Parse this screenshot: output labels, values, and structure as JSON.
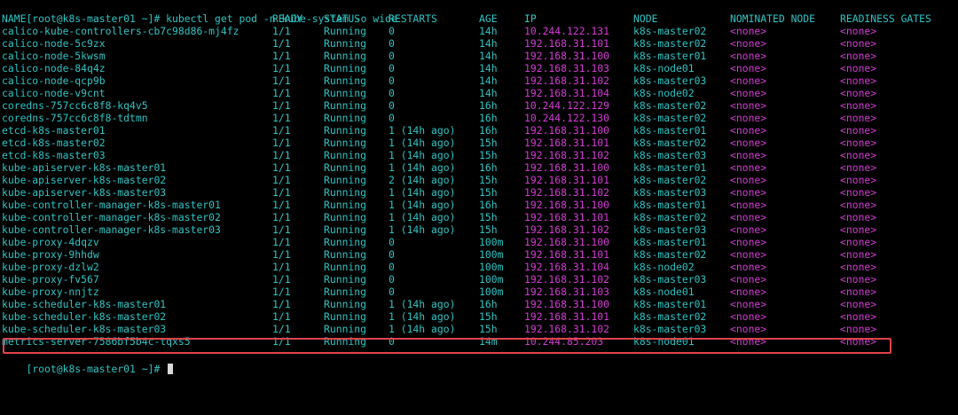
{
  "terminal": {
    "prompt": "[root@k8s-master01 ~]# ",
    "command": "kubectl get pod -n kube-system -o wide",
    "headers": {
      "name": "NAME",
      "ready": "READY",
      "status": "STATUS",
      "restarts": "RESTARTS",
      "age": "AGE",
      "ip": "IP",
      "node": "NODE",
      "nominated": "NOMINATED NODE",
      "readiness": "READINESS GATES"
    },
    "rows": [
      {
        "name": "calico-kube-controllers-cb7c98d86-mj4fz",
        "ready": "1/1",
        "status": "Running",
        "restarts": "0",
        "age": "14h",
        "ip": "10.244.122.131",
        "node": "k8s-master02",
        "nominated": "<none>",
        "readiness": "<none>"
      },
      {
        "name": "calico-node-5c9zx",
        "ready": "1/1",
        "status": "Running",
        "restarts": "0",
        "age": "14h",
        "ip": "192.168.31.101",
        "node": "k8s-master02",
        "nominated": "<none>",
        "readiness": "<none>"
      },
      {
        "name": "calico-node-5kwsm",
        "ready": "1/1",
        "status": "Running",
        "restarts": "0",
        "age": "14h",
        "ip": "192.168.31.100",
        "node": "k8s-master01",
        "nominated": "<none>",
        "readiness": "<none>"
      },
      {
        "name": "calico-node-84q4z",
        "ready": "1/1",
        "status": "Running",
        "restarts": "0",
        "age": "14h",
        "ip": "192.168.31.103",
        "node": "k8s-node01",
        "nominated": "<none>",
        "readiness": "<none>"
      },
      {
        "name": "calico-node-qcp9b",
        "ready": "1/1",
        "status": "Running",
        "restarts": "0",
        "age": "14h",
        "ip": "192.168.31.102",
        "node": "k8s-master03",
        "nominated": "<none>",
        "readiness": "<none>"
      },
      {
        "name": "calico-node-v9cnt",
        "ready": "1/1",
        "status": "Running",
        "restarts": "0",
        "age": "14h",
        "ip": "192.168.31.104",
        "node": "k8s-node02",
        "nominated": "<none>",
        "readiness": "<none>"
      },
      {
        "name": "coredns-757cc6c8f8-kq4v5",
        "ready": "1/1",
        "status": "Running",
        "restarts": "0",
        "age": "16h",
        "ip": "10.244.122.129",
        "node": "k8s-master02",
        "nominated": "<none>",
        "readiness": "<none>"
      },
      {
        "name": "coredns-757cc6c8f8-tdtmn",
        "ready": "1/1",
        "status": "Running",
        "restarts": "0",
        "age": "16h",
        "ip": "10.244.122.130",
        "node": "k8s-master02",
        "nominated": "<none>",
        "readiness": "<none>"
      },
      {
        "name": "etcd-k8s-master01",
        "ready": "1/1",
        "status": "Running",
        "restarts": "1 (14h ago)",
        "age": "16h",
        "ip": "192.168.31.100",
        "node": "k8s-master01",
        "nominated": "<none>",
        "readiness": "<none>"
      },
      {
        "name": "etcd-k8s-master02",
        "ready": "1/1",
        "status": "Running",
        "restarts": "1 (14h ago)",
        "age": "15h",
        "ip": "192.168.31.101",
        "node": "k8s-master02",
        "nominated": "<none>",
        "readiness": "<none>"
      },
      {
        "name": "etcd-k8s-master03",
        "ready": "1/1",
        "status": "Running",
        "restarts": "1 (14h ago)",
        "age": "15h",
        "ip": "192.168.31.102",
        "node": "k8s-master03",
        "nominated": "<none>",
        "readiness": "<none>"
      },
      {
        "name": "kube-apiserver-k8s-master01",
        "ready": "1/1",
        "status": "Running",
        "restarts": "1 (14h ago)",
        "age": "16h",
        "ip": "192.168.31.100",
        "node": "k8s-master01",
        "nominated": "<none>",
        "readiness": "<none>"
      },
      {
        "name": "kube-apiserver-k8s-master02",
        "ready": "1/1",
        "status": "Running",
        "restarts": "2 (14h ago)",
        "age": "15h",
        "ip": "192.168.31.101",
        "node": "k8s-master02",
        "nominated": "<none>",
        "readiness": "<none>"
      },
      {
        "name": "kube-apiserver-k8s-master03",
        "ready": "1/1",
        "status": "Running",
        "restarts": "1 (14h ago)",
        "age": "15h",
        "ip": "192.168.31.102",
        "node": "k8s-master03",
        "nominated": "<none>",
        "readiness": "<none>"
      },
      {
        "name": "kube-controller-manager-k8s-master01",
        "ready": "1/1",
        "status": "Running",
        "restarts": "1 (14h ago)",
        "age": "16h",
        "ip": "192.168.31.100",
        "node": "k8s-master01",
        "nominated": "<none>",
        "readiness": "<none>"
      },
      {
        "name": "kube-controller-manager-k8s-master02",
        "ready": "1/1",
        "status": "Running",
        "restarts": "1 (14h ago)",
        "age": "15h",
        "ip": "192.168.31.101",
        "node": "k8s-master02",
        "nominated": "<none>",
        "readiness": "<none>"
      },
      {
        "name": "kube-controller-manager-k8s-master03",
        "ready": "1/1",
        "status": "Running",
        "restarts": "1 (14h ago)",
        "age": "15h",
        "ip": "192.168.31.102",
        "node": "k8s-master03",
        "nominated": "<none>",
        "readiness": "<none>"
      },
      {
        "name": "kube-proxy-4dqzv",
        "ready": "1/1",
        "status": "Running",
        "restarts": "0",
        "age": "100m",
        "ip": "192.168.31.100",
        "node": "k8s-master01",
        "nominated": "<none>",
        "readiness": "<none>"
      },
      {
        "name": "kube-proxy-9hhdw",
        "ready": "1/1",
        "status": "Running",
        "restarts": "0",
        "age": "100m",
        "ip": "192.168.31.101",
        "node": "k8s-master02",
        "nominated": "<none>",
        "readiness": "<none>"
      },
      {
        "name": "kube-proxy-dzlw2",
        "ready": "1/1",
        "status": "Running",
        "restarts": "0",
        "age": "100m",
        "ip": "192.168.31.104",
        "node": "k8s-node02",
        "nominated": "<none>",
        "readiness": "<none>"
      },
      {
        "name": "kube-proxy-fv567",
        "ready": "1/1",
        "status": "Running",
        "restarts": "0",
        "age": "100m",
        "ip": "192.168.31.102",
        "node": "k8s-master03",
        "nominated": "<none>",
        "readiness": "<none>"
      },
      {
        "name": "kube-proxy-nnjtz",
        "ready": "1/1",
        "status": "Running",
        "restarts": "0",
        "age": "100m",
        "ip": "192.168.31.103",
        "node": "k8s-node01",
        "nominated": "<none>",
        "readiness": "<none>"
      },
      {
        "name": "kube-scheduler-k8s-master01",
        "ready": "1/1",
        "status": "Running",
        "restarts": "1 (14h ago)",
        "age": "16h",
        "ip": "192.168.31.100",
        "node": "k8s-master01",
        "nominated": "<none>",
        "readiness": "<none>"
      },
      {
        "name": "kube-scheduler-k8s-master02",
        "ready": "1/1",
        "status": "Running",
        "restarts": "1 (14h ago)",
        "age": "15h",
        "ip": "192.168.31.101",
        "node": "k8s-master02",
        "nominated": "<none>",
        "readiness": "<none>"
      },
      {
        "name": "kube-scheduler-k8s-master03",
        "ready": "1/1",
        "status": "Running",
        "restarts": "1 (14h ago)",
        "age": "15h",
        "ip": "192.168.31.102",
        "node": "k8s-master03",
        "nominated": "<none>",
        "readiness": "<none>"
      },
      {
        "name": "metrics-server-7586bf5b4c-tqxs5",
        "ready": "1/1",
        "status": "Running",
        "restarts": "0",
        "age": "14m",
        "ip": "10.244.85.203",
        "node": "k8s-node01",
        "nominated": "<none>",
        "readiness": "<none>"
      }
    ],
    "highlighted_row": 25
  },
  "colors": {
    "background": "#000000",
    "text": "#2ec4c4",
    "ip_and_none": "#d63bd6",
    "highlight_border": "#e0444b"
  }
}
